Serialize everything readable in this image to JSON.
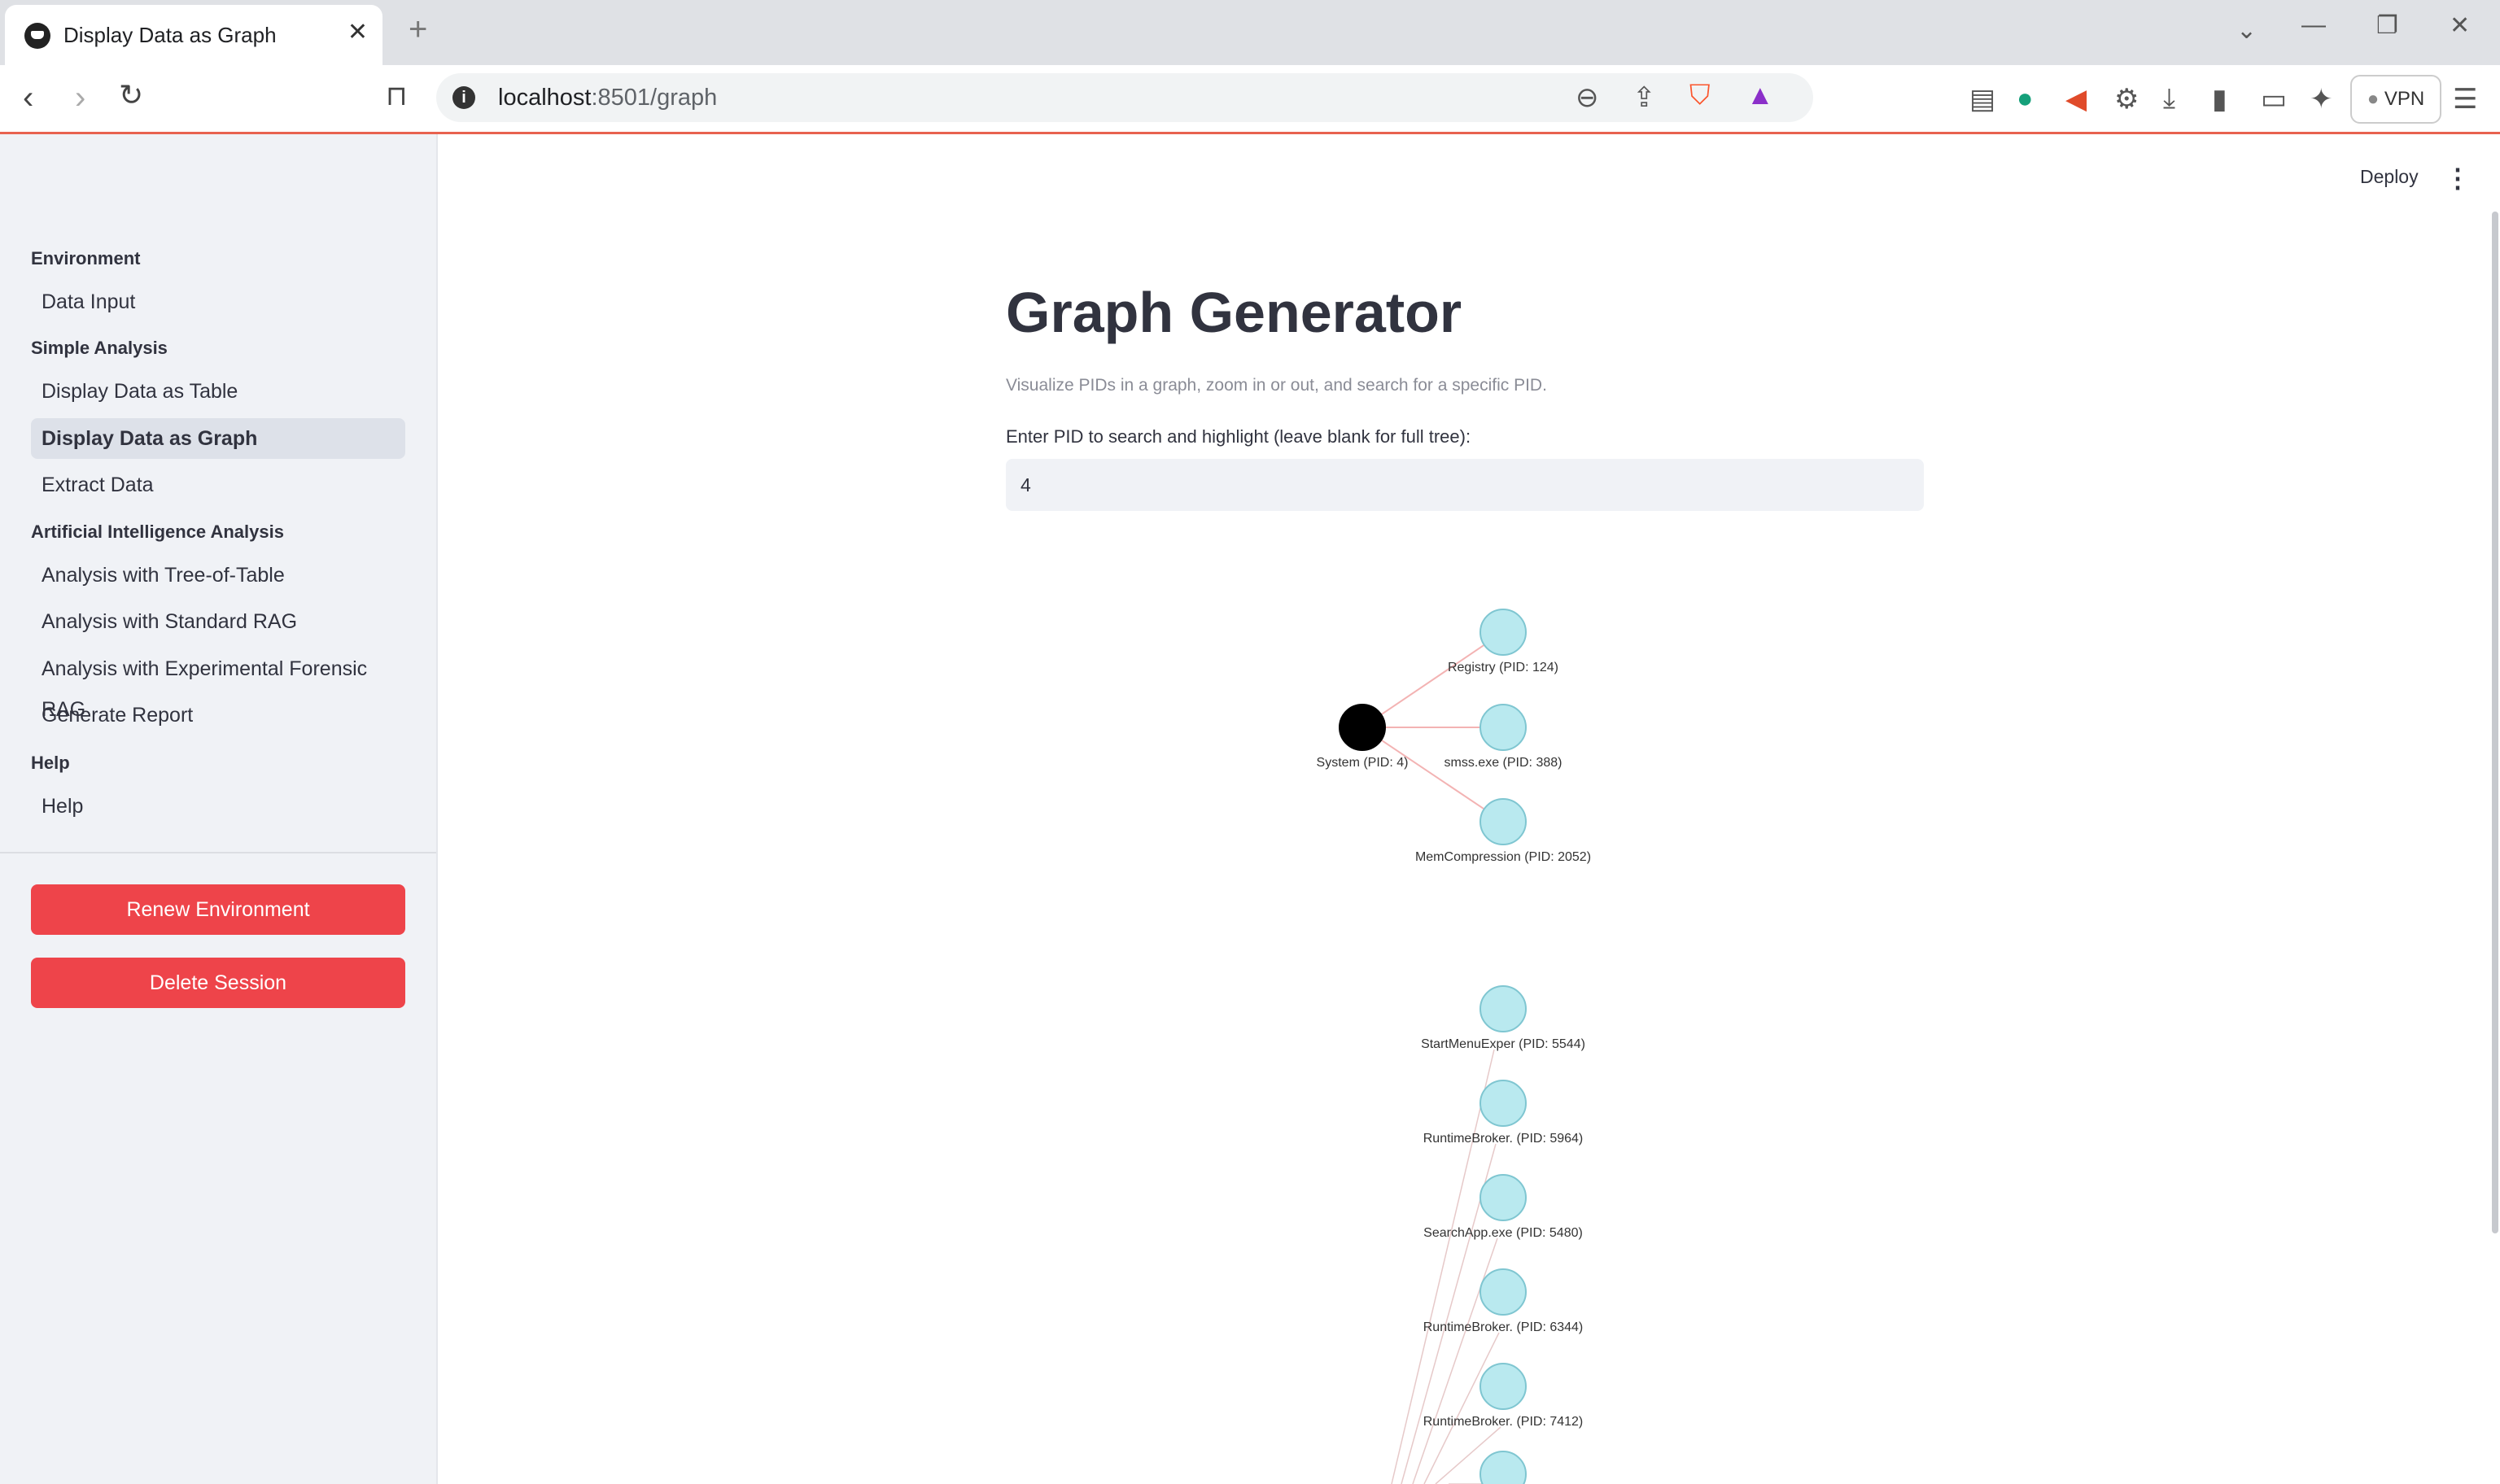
{
  "browser": {
    "tab_title": "Display Data as Graph",
    "tab_close": "✕",
    "new_tab": "+",
    "url_host": "localhost",
    "url_rest": ":8501/graph",
    "vpn_label": "VPN"
  },
  "sidebar": {
    "sections": [
      {
        "title": "Environment"
      },
      {
        "title": "Simple Analysis"
      },
      {
        "title": "Artificial Intelligence Analysis"
      },
      {
        "title": "Help"
      }
    ],
    "items": [
      {
        "label": "Data Input"
      },
      {
        "label": "Display Data as Table"
      },
      {
        "label": "Display Data as Graph",
        "active": true
      },
      {
        "label": "Extract Data"
      },
      {
        "label": "Analysis with Tree-of-Table"
      },
      {
        "label": "Analysis with Standard RAG"
      },
      {
        "label": "Analysis with Experimental Forensic RAG"
      },
      {
        "label": "Generate Report"
      },
      {
        "label": "Help"
      }
    ],
    "renew_button": "Renew Environment",
    "delete_button": "Delete Session"
  },
  "header": {
    "deploy_label": "Deploy",
    "menu_icon": "⋮"
  },
  "main": {
    "title": "Graph Generator",
    "caption": "Visualize PIDs in a graph, zoom in or out, and search for a specific PID.",
    "input_label": "Enter PID to search and highlight (leave blank for full tree):",
    "input_value": "4"
  },
  "graph": {
    "highlight_color": "#000000",
    "node_color": "#b9e9ef",
    "edge_color": "#f3b3b3",
    "nodes": [
      {
        "label": "System (PID: 4)",
        "highlighted": true
      },
      {
        "label": "Registry (PID: 124)"
      },
      {
        "label": "smss.exe (PID: 388)"
      },
      {
        "label": "MemCompression (PID: 2052)"
      },
      {
        "label": "StartMenuExper (PID: 5544)"
      },
      {
        "label": "RuntimeBroker. (PID: 5964)"
      },
      {
        "label": "SearchApp.exe (PID: 5480)"
      },
      {
        "label": "RuntimeBroker. (PID: 6344)"
      },
      {
        "label": "RuntimeBroker. (PID: 7412)"
      },
      {
        "label": ""
      }
    ]
  }
}
